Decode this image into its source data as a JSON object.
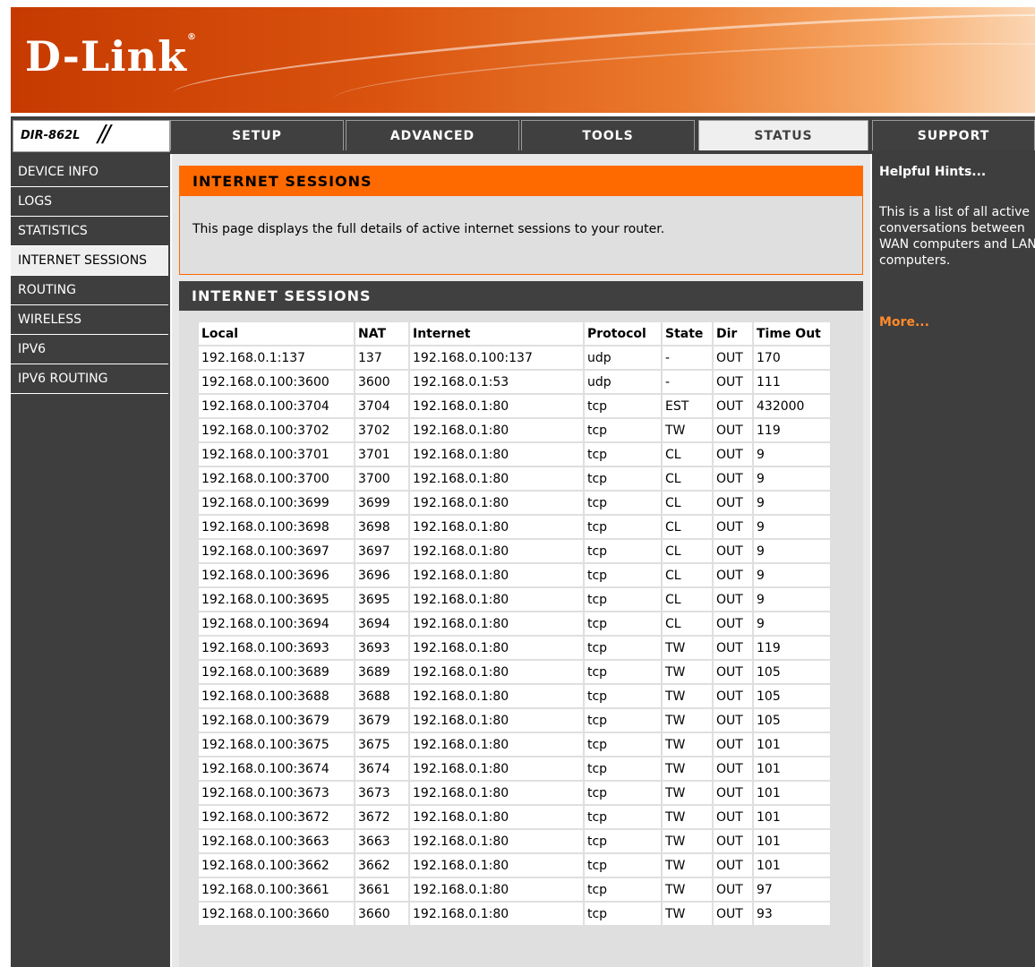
{
  "header": {
    "logo": "D-Link",
    "reg": "®"
  },
  "nav": {
    "model": "DIR-862L",
    "slashes": "//",
    "tabs": [
      "SETUP",
      "ADVANCED",
      "TOOLS",
      "STATUS",
      "SUPPORT"
    ],
    "active_tab": "STATUS"
  },
  "sidebar": {
    "items": [
      "DEVICE INFO",
      "LOGS",
      "STATISTICS",
      "INTERNET SESSIONS",
      "ROUTING",
      "WIRELESS",
      "IPV6",
      "IPV6 ROUTING"
    ],
    "active_item": "INTERNET SESSIONS"
  },
  "intro": {
    "title": "INTERNET SESSIONS",
    "text": "This page displays the full details of active internet sessions to your router."
  },
  "sessions": {
    "title": "INTERNET SESSIONS",
    "columns": [
      "Local",
      "NAT",
      "Internet",
      "Protocol",
      "State",
      "Dir",
      "Time Out"
    ],
    "rows": [
      [
        "192.168.0.1:137",
        "137",
        "192.168.0.100:137",
        "udp",
        "-",
        "OUT",
        "170"
      ],
      [
        "192.168.0.100:3600",
        "3600",
        "192.168.0.1:53",
        "udp",
        "-",
        "OUT",
        "111"
      ],
      [
        "192.168.0.100:3704",
        "3704",
        "192.168.0.1:80",
        "tcp",
        "EST",
        "OUT",
        "432000"
      ],
      [
        "192.168.0.100:3702",
        "3702",
        "192.168.0.1:80",
        "tcp",
        "TW",
        "OUT",
        "119"
      ],
      [
        "192.168.0.100:3701",
        "3701",
        "192.168.0.1:80",
        "tcp",
        "CL",
        "OUT",
        "9"
      ],
      [
        "192.168.0.100:3700",
        "3700",
        "192.168.0.1:80",
        "tcp",
        "CL",
        "OUT",
        "9"
      ],
      [
        "192.168.0.100:3699",
        "3699",
        "192.168.0.1:80",
        "tcp",
        "CL",
        "OUT",
        "9"
      ],
      [
        "192.168.0.100:3698",
        "3698",
        "192.168.0.1:80",
        "tcp",
        "CL",
        "OUT",
        "9"
      ],
      [
        "192.168.0.100:3697",
        "3697",
        "192.168.0.1:80",
        "tcp",
        "CL",
        "OUT",
        "9"
      ],
      [
        "192.168.0.100:3696",
        "3696",
        "192.168.0.1:80",
        "tcp",
        "CL",
        "OUT",
        "9"
      ],
      [
        "192.168.0.100:3695",
        "3695",
        "192.168.0.1:80",
        "tcp",
        "CL",
        "OUT",
        "9"
      ],
      [
        "192.168.0.100:3694",
        "3694",
        "192.168.0.1:80",
        "tcp",
        "CL",
        "OUT",
        "9"
      ],
      [
        "192.168.0.100:3693",
        "3693",
        "192.168.0.1:80",
        "tcp",
        "TW",
        "OUT",
        "119"
      ],
      [
        "192.168.0.100:3689",
        "3689",
        "192.168.0.1:80",
        "tcp",
        "TW",
        "OUT",
        "105"
      ],
      [
        "192.168.0.100:3688",
        "3688",
        "192.168.0.1:80",
        "tcp",
        "TW",
        "OUT",
        "105"
      ],
      [
        "192.168.0.100:3679",
        "3679",
        "192.168.0.1:80",
        "tcp",
        "TW",
        "OUT",
        "105"
      ],
      [
        "192.168.0.100:3675",
        "3675",
        "192.168.0.1:80",
        "tcp",
        "TW",
        "OUT",
        "101"
      ],
      [
        "192.168.0.100:3674",
        "3674",
        "192.168.0.1:80",
        "tcp",
        "TW",
        "OUT",
        "101"
      ],
      [
        "192.168.0.100:3673",
        "3673",
        "192.168.0.1:80",
        "tcp",
        "TW",
        "OUT",
        "101"
      ],
      [
        "192.168.0.100:3672",
        "3672",
        "192.168.0.1:80",
        "tcp",
        "TW",
        "OUT",
        "101"
      ],
      [
        "192.168.0.100:3663",
        "3663",
        "192.168.0.1:80",
        "tcp",
        "TW",
        "OUT",
        "101"
      ],
      [
        "192.168.0.100:3662",
        "3662",
        "192.168.0.1:80",
        "tcp",
        "TW",
        "OUT",
        "101"
      ],
      [
        "192.168.0.100:3661",
        "3661",
        "192.168.0.1:80",
        "tcp",
        "TW",
        "OUT",
        "97"
      ],
      [
        "192.168.0.100:3660",
        "3660",
        "192.168.0.1:80",
        "tcp",
        "TW",
        "OUT",
        "93"
      ]
    ]
  },
  "hints": {
    "title": "Helpful Hints...",
    "text": "This is a list of all active conversations between WAN computers and LAN computers.",
    "more": "More..."
  },
  "colors": {
    "brand_orange": "#ff6a00",
    "nav_dark": "#404040",
    "panel_grey": "#dfdfdf",
    "link_orange": "#ff8a2a"
  }
}
